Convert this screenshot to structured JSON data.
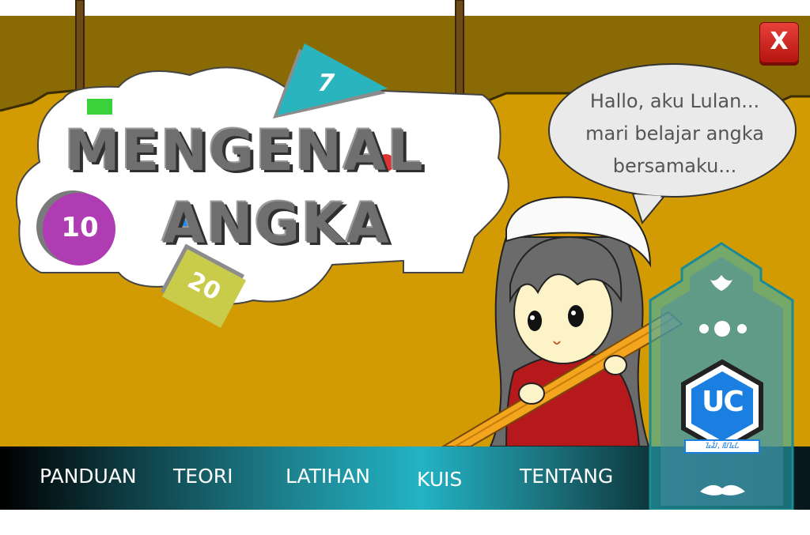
{
  "title": {
    "line1": "MENGENAL",
    "line2": "ANGKA"
  },
  "badges": {
    "ten": "10",
    "seven": "7",
    "twenty": "20"
  },
  "speech_bubble": {
    "line1": "Hallo, aku Lulan...",
    "line2": "mari belajar angka",
    "line3": "bersamaku..."
  },
  "close_button": {
    "label": "X"
  },
  "nav": {
    "items": [
      {
        "label": "PANDUAN"
      },
      {
        "label": "TEORI"
      },
      {
        "label": "LATIHAN"
      },
      {
        "label": "KUIS"
      },
      {
        "label": "TENTANG"
      }
    ]
  },
  "logo": {
    "text": "UC",
    "caption": "ᮅᮎᮤ, ᮜᮅᮄ"
  },
  "colors": {
    "background": "#d39b03",
    "background_dark": "#8a6a04",
    "close_red": "#d42a22",
    "badge_purple": "#b03cb4",
    "badge_teal": "#2ab4bd",
    "badge_yellow": "#c9cc4a",
    "navbar_accent": "#22b3c4"
  }
}
